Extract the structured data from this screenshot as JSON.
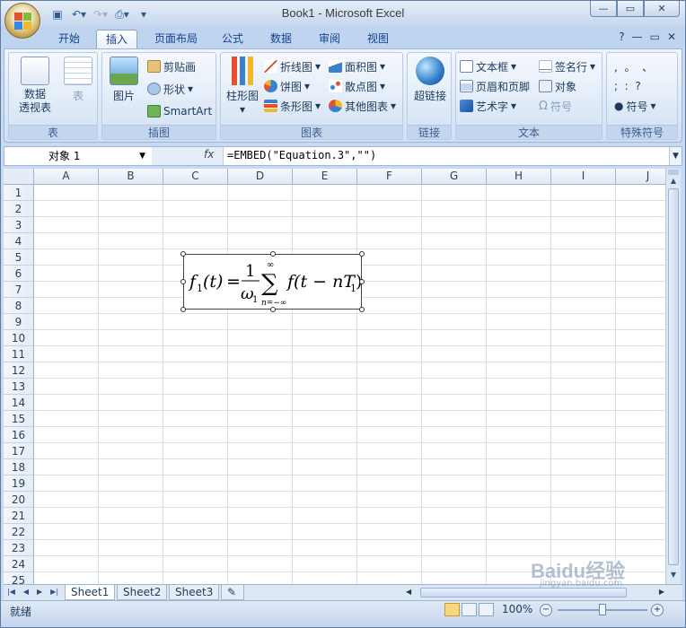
{
  "window": {
    "title": "Book1 - Microsoft Excel"
  },
  "ribbon_tabs": [
    {
      "label": "开始"
    },
    {
      "label": "插入",
      "active": true
    },
    {
      "label": "页面布局"
    },
    {
      "label": "公式"
    },
    {
      "label": "数据"
    },
    {
      "label": "审阅"
    },
    {
      "label": "视图"
    }
  ],
  "ribbon": {
    "groups": {
      "table": {
        "label": "表",
        "pivot": "数据\n透视表",
        "table": "表"
      },
      "illustrations": {
        "label": "插图",
        "picture": "图片",
        "clipart": "剪贴画",
        "shapes": "形状",
        "smartart": "SmartArt"
      },
      "charts": {
        "label": "图表",
        "column": "柱形图",
        "line": "折线图",
        "pie": "饼图",
        "bar": "条形图",
        "area": "面积图",
        "scatter": "散点图",
        "other": "其他图表"
      },
      "links": {
        "label": "链接",
        "hyperlink": "超链接"
      },
      "text": {
        "label": "文本",
        "textbox": "文本框",
        "header_footer": "页眉和页脚",
        "wordart": "艺术字",
        "signature": "签名行",
        "object": "对象",
        "symbol": "符号"
      },
      "special": {
        "label": "特殊符号",
        "chars_row1": ",  。  、",
        "chars_row2": ";  :  ?",
        "symbol": "符号"
      }
    }
  },
  "formula_bar": {
    "name_box": "对象 1",
    "fx": "fx",
    "formula": "=EMBED(\"Equation.3\",\"\")"
  },
  "columns": [
    "A",
    "B",
    "C",
    "D",
    "E",
    "F",
    "G",
    "H",
    "I",
    "J"
  ],
  "rows": [
    "1",
    "2",
    "3",
    "4",
    "5",
    "6",
    "7",
    "8",
    "9",
    "10",
    "11",
    "12",
    "13",
    "14",
    "15",
    "16",
    "17",
    "18",
    "19",
    "20",
    "21",
    "22",
    "23",
    "24",
    "25"
  ],
  "equation": {
    "lhs": "f",
    "lhs_sub": "1",
    "lhs_arg": "(t)",
    "equals": "=",
    "num": "1",
    "den": "ω",
    "den_sub": "1",
    "sum": "∑",
    "upper": "∞",
    "lower": "n=−∞",
    "rhs": "f(t − nT",
    "rhs_sub": "1",
    "rhs_close": ")"
  },
  "sheet_tabs": [
    {
      "label": "Sheet1",
      "active": true
    },
    {
      "label": "Sheet2"
    },
    {
      "label": "Sheet3"
    }
  ],
  "status": {
    "ready": "就绪",
    "zoom": "100%"
  },
  "watermark": {
    "brand": "Baidu经验",
    "url": "jingyan.baidu.com"
  }
}
